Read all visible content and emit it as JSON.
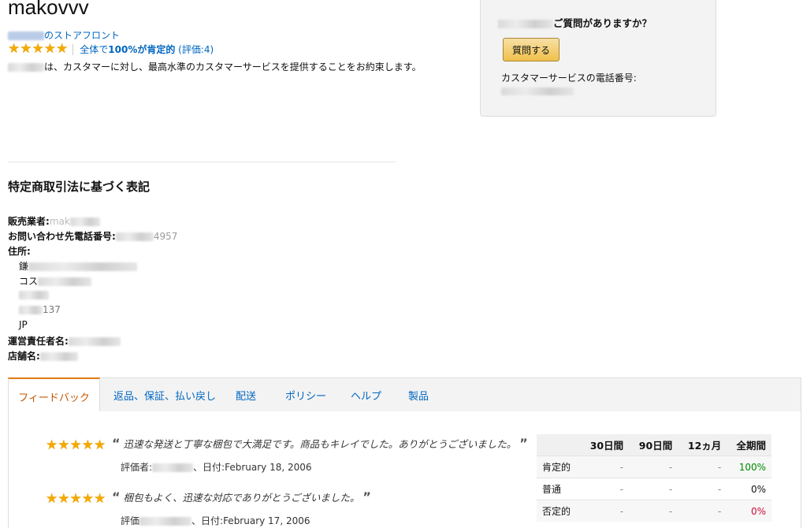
{
  "store": {
    "title": "makovvv",
    "storefront_suffix": "のストアフロント",
    "rating_summary_prefix": "全体で",
    "rating_summary_bold": "100%が肯定的",
    "rating_summary_count": "(評価:4)",
    "promise_text": "は、カスタマーに対し、最高水準のカスタマーサービスを提供することをお約束します。"
  },
  "ask": {
    "question": "ご質問がありますか？",
    "button_label": "質問する",
    "phone_label": "カスタマーサービスの電話番号:"
  },
  "legal": {
    "heading": "特定商取引法に基づく表記",
    "seller_label": "販売業者:",
    "seller_value": "mak",
    "phone_label": "お問い合わせ先電話番号:",
    "phone_value": "4957",
    "address_label": "住所:",
    "address_lines": [
      "鎌",
      "コス",
      "",
      "137",
      "JP"
    ],
    "manager_label": "運営責任者名:",
    "shop_label": "店舗名:"
  },
  "tabs": [
    {
      "label": "フィードバック"
    },
    {
      "label": "返品、保証、払い戻し"
    },
    {
      "label": "配送"
    },
    {
      "label": "ポリシー"
    },
    {
      "label": "ヘルプ"
    },
    {
      "label": "製品"
    }
  ],
  "feedback": [
    {
      "text": "迅速な発送と丁寧な梱包で大満足です。商品もキレイでした。ありがとうございました。",
      "rater_label": "評価者:",
      "date_label": "、日付:",
      "date": "February 18, 2006"
    },
    {
      "text": "梱包もよく、迅速な対応でありがとうございました。",
      "rater_label": "評価",
      "date_label": "、日付:",
      "date": "February 17, 2006"
    }
  ],
  "feedback_table": {
    "headers": [
      "",
      "30日間",
      "90日間",
      "12ヵ月",
      "全期間"
    ],
    "rows": [
      {
        "label": "肯定的",
        "values": [
          "-",
          "-",
          "-",
          "100%"
        ],
        "accent": "#008a00"
      },
      {
        "label": "普通",
        "values": [
          "-",
          "-",
          "-",
          "0%"
        ],
        "accent": "#111111"
      },
      {
        "label": "否定的",
        "values": [
          "-",
          "-",
          "-",
          "0%"
        ],
        "accent": "#cc0c39"
      }
    ]
  },
  "icons": {
    "star": "star-icon"
  },
  "colors": {
    "link": "#0066c0",
    "active_tab": "#c45500",
    "star": "#f4a900"
  }
}
